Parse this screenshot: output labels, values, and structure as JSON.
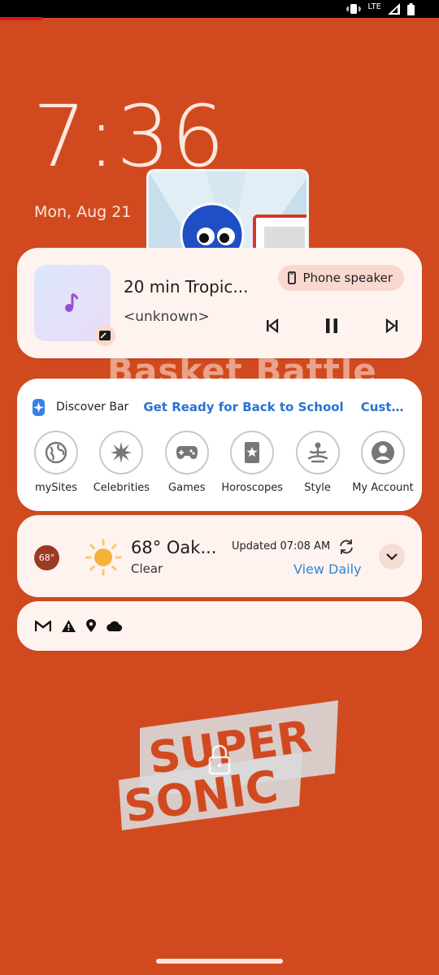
{
  "status_bar": {
    "network": "LTE",
    "icons": [
      "vibrate-icon",
      "signal-icon",
      "battery-icon"
    ]
  },
  "lockscreen": {
    "time": "7:36",
    "date": "Mon, Aug 21"
  },
  "background": {
    "game_title": "Basket Battle",
    "logo_line1": "SUPER",
    "logo_line2": "SONIC"
  },
  "media": {
    "title": "20 min Tropic...",
    "artist": "<unknown>",
    "output_label": "Phone speaker",
    "controls": [
      "previous-icon",
      "pause-icon",
      "next-icon"
    ]
  },
  "discover": {
    "label": "Discover Bar",
    "link1": "Get Ready for Back to School",
    "link2": "Customi...",
    "shortcuts": [
      {
        "label": "mySites",
        "icon": "globe-icon"
      },
      {
        "label": "Celebrities",
        "icon": "star-burst-icon"
      },
      {
        "label": "Games",
        "icon": "gamepad-icon"
      },
      {
        "label": "Horoscopes",
        "icon": "tarot-card-icon"
      },
      {
        "label": "Style",
        "icon": "meditation-icon"
      },
      {
        "label": "My Account",
        "icon": "account-icon"
      }
    ]
  },
  "weather": {
    "badge": "68°",
    "headline": "68° Oak...",
    "condition": "Clear",
    "updated": "Updated 07:08 AM",
    "view_daily": "View Daily"
  },
  "notifications": {
    "icons": [
      "gmail-icon",
      "alert-icon",
      "location-icon",
      "cloud-icon"
    ]
  },
  "colors": {
    "background": "#D14A1F",
    "card": "#FFF3EF",
    "accent_link": "#2872D4"
  }
}
